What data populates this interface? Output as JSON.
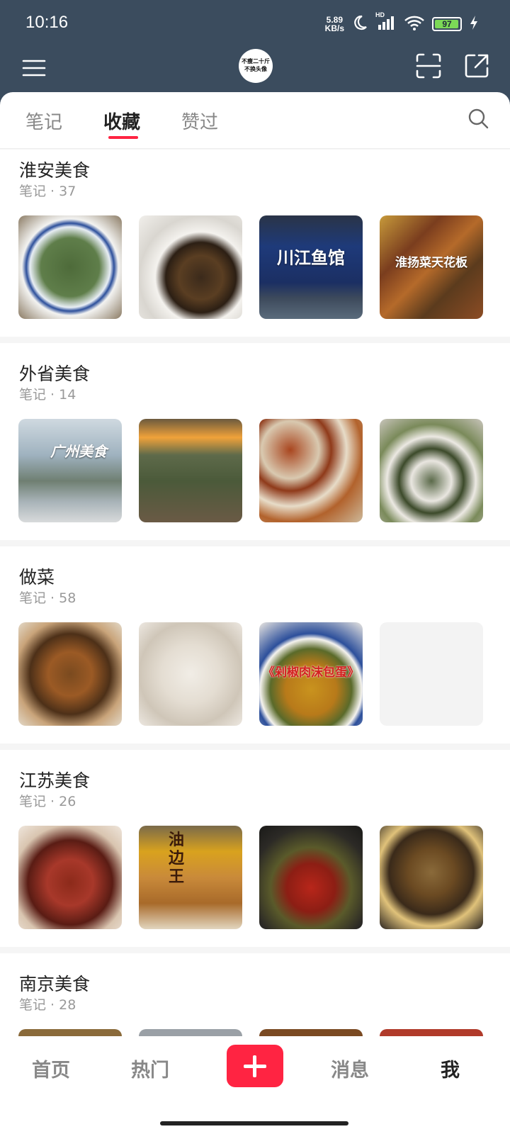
{
  "status_bar": {
    "time": "10:16",
    "net_speed_value": "5.89",
    "net_speed_unit": "KB/s",
    "network_label": "HD",
    "battery": "97",
    "battery_level": 0.97,
    "icons": [
      "moon-icon",
      "signal-icon",
      "wifi-icon",
      "battery-icon",
      "charging-icon"
    ]
  },
  "header": {
    "avatar_text_line1": "不瘦二十斤",
    "avatar_text_line2": "不换头像",
    "icons": [
      "menu-icon",
      "scan-icon",
      "share-icon"
    ]
  },
  "tabs": {
    "items": [
      {
        "label": "笔记",
        "active": false
      },
      {
        "label": "收藏",
        "active": true
      },
      {
        "label": "赞过",
        "active": false
      }
    ],
    "accent": "#ff2442"
  },
  "collections": [
    {
      "title": "淮安美食",
      "meta": "笔记 · 37",
      "thumb_captions": [
        "",
        "",
        "川江鱼馆",
        "淮扬菜天花板"
      ]
    },
    {
      "title": "外省美食",
      "meta": "笔记 · 14",
      "thumb_captions": [
        "广州美食",
        "",
        "",
        ""
      ]
    },
    {
      "title": "做菜",
      "meta": "笔记 · 58",
      "thumb_captions": [
        "",
        "",
        "《剁椒肉沫包蛋》",
        ""
      ]
    },
    {
      "title": "江苏美食",
      "meta": "笔记 · 26",
      "thumb_captions": [
        "",
        "油边王",
        "",
        ""
      ]
    },
    {
      "title": "南京美食",
      "meta": "笔记 · 28",
      "thumb_captions": [
        "",
        "",
        "",
        ""
      ]
    }
  ],
  "bottom_nav": {
    "items": [
      "首页",
      "热门",
      "消息",
      "我"
    ],
    "active": "我",
    "publish_color": "#ff2442"
  }
}
